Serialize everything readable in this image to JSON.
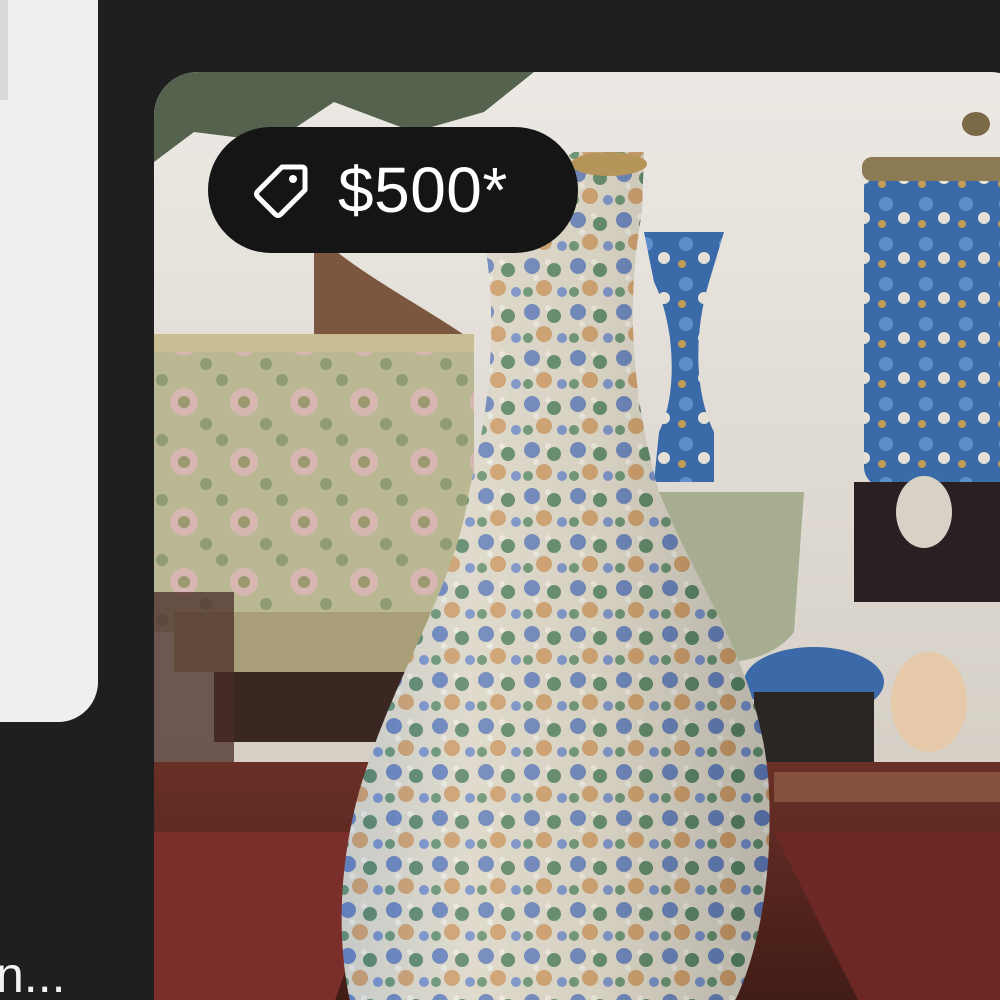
{
  "left_card": {
    "caption": "n..."
  },
  "listing": {
    "price_badge": {
      "icon": "price-tag-icon",
      "price": "$500*"
    },
    "photo": {
      "subject": "cloisonne-vase-photo"
    }
  },
  "colors": {
    "background": "#1f1f1f",
    "left_card": "#efeff0",
    "badge_bg": "#151515",
    "badge_text": "#ffffff"
  }
}
